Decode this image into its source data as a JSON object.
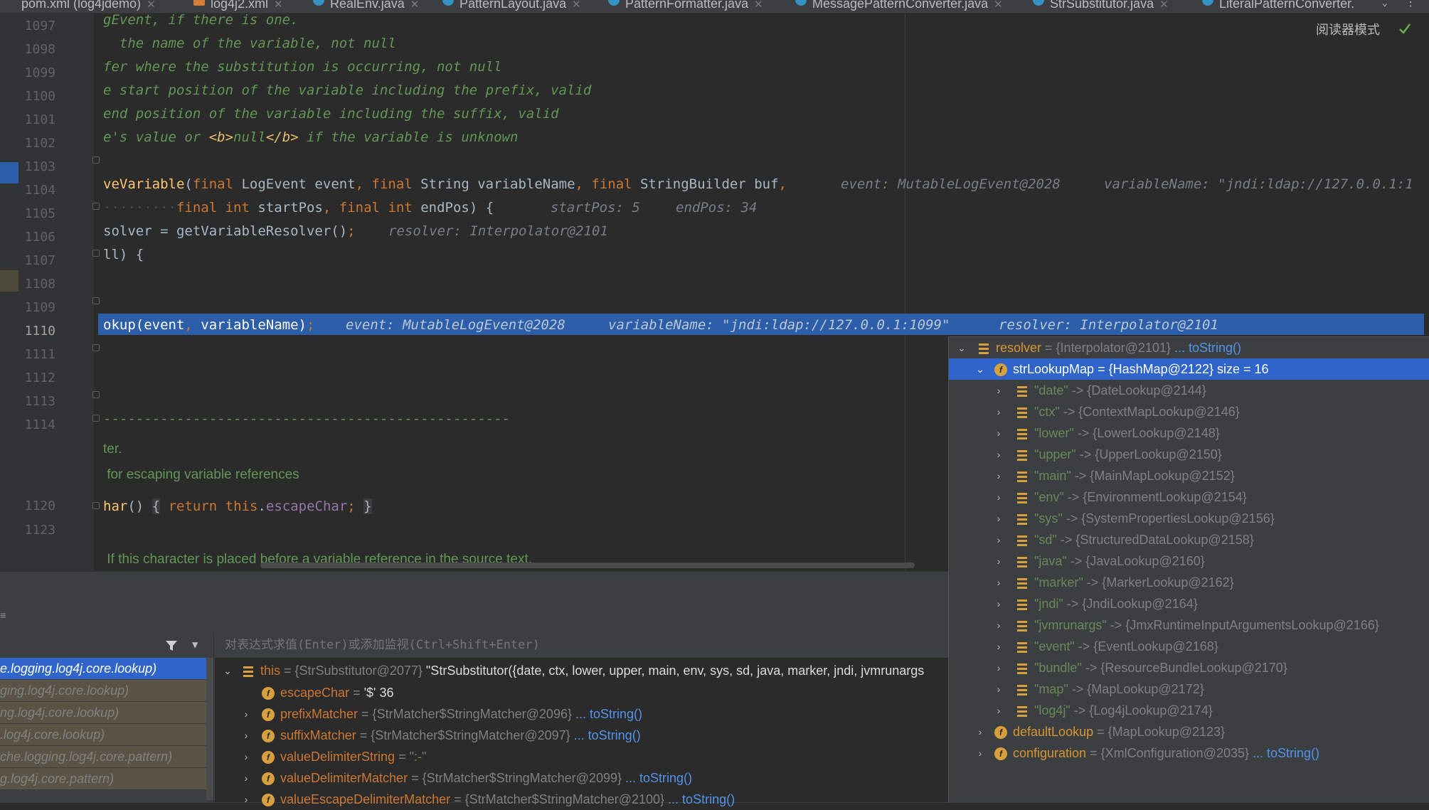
{
  "tabs": [
    {
      "label": "pom.xml (log4jdemo)",
      "kind": "xml-plain"
    },
    {
      "label": "log4j2.xml",
      "kind": "xml"
    },
    {
      "label": "RealEnv.java",
      "kind": "java"
    },
    {
      "label": "PatternLayout.java",
      "kind": "java"
    },
    {
      "label": "PatternFormatter.java",
      "kind": "java"
    },
    {
      "label": "MessagePatternConverter.java",
      "kind": "java"
    },
    {
      "label": "StrSubstitutor.java",
      "kind": "java",
      "active": true
    },
    {
      "label": "LiteralPatternConverter.",
      "kind": "java"
    }
  ],
  "editor": {
    "reader_mode": "阅读器模式",
    "line_numbers": [
      "1097",
      "1098",
      "1099",
      "1100",
      "1101",
      "1102",
      "1103",
      "1104",
      "1105",
      "1106",
      "1107",
      "1108",
      "1109",
      "1110",
      "1111",
      "1112",
      "1113",
      "1114",
      "1120",
      "1123"
    ],
    "lines": {
      "l1097": "gEvent, if there is one.",
      "l1098": "  the name of the variable, not null",
      "l1099": "fer where the substitution is occurring, not null",
      "l1100": "e start position of the variable including the prefix, valid",
      "l1101": "end position of the variable including the suffix, valid",
      "l1102a": "e's value or ",
      "l1102b": "<b>",
      "l1102c": "null",
      "l1102d": "</b>",
      "l1102e": " if the variable is unknown",
      "l1104_name": "veVariable",
      "l1104_p1": "(",
      "l1104_kw1": "final",
      "l1104_t1": " LogEvent event",
      "l1104_c1": ", ",
      "l1104_kw2": "final",
      "l1104_t2": " String variableName",
      "l1104_c2": ", ",
      "l1104_kw3": "final",
      "l1104_t3": " StringBuilder buf",
      "l1104_c3": ",",
      "l1104_hint1": "event: MutableLogEvent@2028",
      "l1104_hint2": "variableName: \"jndi:ldap://127.0.0.1:1",
      "l1105_dots": "·········",
      "l1105_kw1": "final",
      "l1105_kw2": "int",
      "l1105_t1": " startPos",
      "l1105_c1": ", ",
      "l1105_kw3": "final",
      "l1105_kw4": "int",
      "l1105_t2": " endPos) {",
      "l1105_hint1": "startPos: 5",
      "l1105_hint2": "endPos: 34",
      "l1106_t": "solver = getVariableResolver()",
      "l1106_semi": ";",
      "l1106_hint": "resolver: Interpolator@2101",
      "l1107": "ll) {",
      "l1110_t": "okup(event",
      "l1110_c": ", ",
      "l1110_t2": "variableName)",
      "l1110_semi": ";",
      "l1110_hint1": "event: MutableLogEvent@2028",
      "l1110_hint2": "variableName: \"jndi:ldap://127.0.0.1:1099\"",
      "l1110_hint3": "resolver: Interpolator@2101",
      "l1114": "--------------------------------------------------",
      "l_ter": "ter.",
      "l_for": " for escaping variable references",
      "l1120_name": "har",
      "l1120_paren": "() ",
      "l1120_ob": "{",
      "l1120_kw": "return",
      "l1120_this": "this",
      "l1120_dot": ".",
      "l1120_fld": "escapeChar",
      "l1120_semi": ";",
      "l1120_cb": "}",
      "l_if": " If this character is placed before a variable reference in the source text,"
    }
  },
  "popup": {
    "rows": [
      {
        "name": "resolver",
        "val": " = {Interpolator@2101}",
        "link": " ... toString()",
        "icon": "list"
      },
      {
        "name": "strLookupMap",
        "val": " = {HashMap@2122}  size = 16",
        "icon": "field",
        "selected": true
      },
      {
        "name": "\"date\"",
        "val": " -> {DateLookup@2144}",
        "icon": "list"
      },
      {
        "name": "\"ctx\"",
        "val": " -> {ContextMapLookup@2146}",
        "icon": "list"
      },
      {
        "name": "\"lower\"",
        "val": " -> {LowerLookup@2148}",
        "icon": "list"
      },
      {
        "name": "\"upper\"",
        "val": " -> {UpperLookup@2150}",
        "icon": "list"
      },
      {
        "name": "\"main\"",
        "val": " -> {MainMapLookup@2152}",
        "icon": "list"
      },
      {
        "name": "\"env\"",
        "val": " -> {EnvironmentLookup@2154}",
        "icon": "list"
      },
      {
        "name": "\"sys\"",
        "val": " -> {SystemPropertiesLookup@2156}",
        "icon": "list"
      },
      {
        "name": "\"sd\"",
        "val": " -> {StructuredDataLookup@2158}",
        "icon": "list"
      },
      {
        "name": "\"java\"",
        "val": " -> {JavaLookup@2160}",
        "icon": "list"
      },
      {
        "name": "\"marker\"",
        "val": " -> {MarkerLookup@2162}",
        "icon": "list"
      },
      {
        "name": "\"jndi\"",
        "val": " -> {JndiLookup@2164}",
        "icon": "list"
      },
      {
        "name": "\"jvmrunargs\"",
        "val": " -> {JmxRuntimeInputArgumentsLookup@2166}",
        "icon": "list"
      },
      {
        "name": "\"event\"",
        "val": " -> {EventLookup@2168}",
        "icon": "list"
      },
      {
        "name": "\"bundle\"",
        "val": " -> {ResourceBundleLookup@2170}",
        "icon": "list"
      },
      {
        "name": "\"map\"",
        "val": " -> {MapLookup@2172}",
        "icon": "list"
      },
      {
        "name": "\"log4j\"",
        "val": " -> {Log4jLookup@2174}",
        "icon": "list"
      },
      {
        "name": "defaultLookup",
        "val": " = {MapLookup@2123}",
        "icon": "field"
      },
      {
        "name": "configuration",
        "val": " = {XmlConfiguration@2035}",
        "link": " ... toString()",
        "icon": "field"
      }
    ]
  },
  "frames": {
    "items": [
      "e.logging.log4j.core.lookup)",
      "ging.log4j.core.lookup)",
      "ng.log4j.core.lookup)",
      ".log4j.core.lookup)",
      "che.logging.log4j.core.pattern)",
      "g.log4j.core.pattern)"
    ]
  },
  "variables": {
    "expr_placeholder": "对表达式求值(Enter)或添加监视(Ctrl+Shift+Enter)",
    "rows": [
      {
        "name": "this",
        "val": " = {StrSubstitutor@2077} ",
        "extra": "\"StrSubstitutor({date, ctx, lower, upper, main, env, sys, sd, java, marker, jndi, jvmrunargs",
        "icon": "list",
        "arrow": "down"
      },
      {
        "name": "escapeChar",
        "val": " = ",
        "str": "'$' 36",
        "icon": "field"
      },
      {
        "name": "prefixMatcher",
        "val": " = {StrMatcher$StringMatcher@2096}",
        "link": " ... toString()",
        "icon": "field",
        "arrow": "right"
      },
      {
        "name": "suffixMatcher",
        "val": " = {StrMatcher$StringMatcher@2097}",
        "link": " ... toString()",
        "icon": "field",
        "arrow": "right"
      },
      {
        "name": "valueDelimiterString",
        "val": " = ",
        "str": "\":-\"",
        "icon": "field",
        "arrow": "right"
      },
      {
        "name": "valueDelimiterMatcher",
        "val": " = {StrMatcher$StringMatcher@2099}",
        "link": " ... toString()",
        "icon": "field",
        "arrow": "right"
      },
      {
        "name": "valueEscapeDelimiterMatcher",
        "val": " = {StrMatcher$StringMatcher@2100}",
        "link": " ... toString()",
        "icon": "field",
        "arrow": "right"
      }
    ]
  }
}
